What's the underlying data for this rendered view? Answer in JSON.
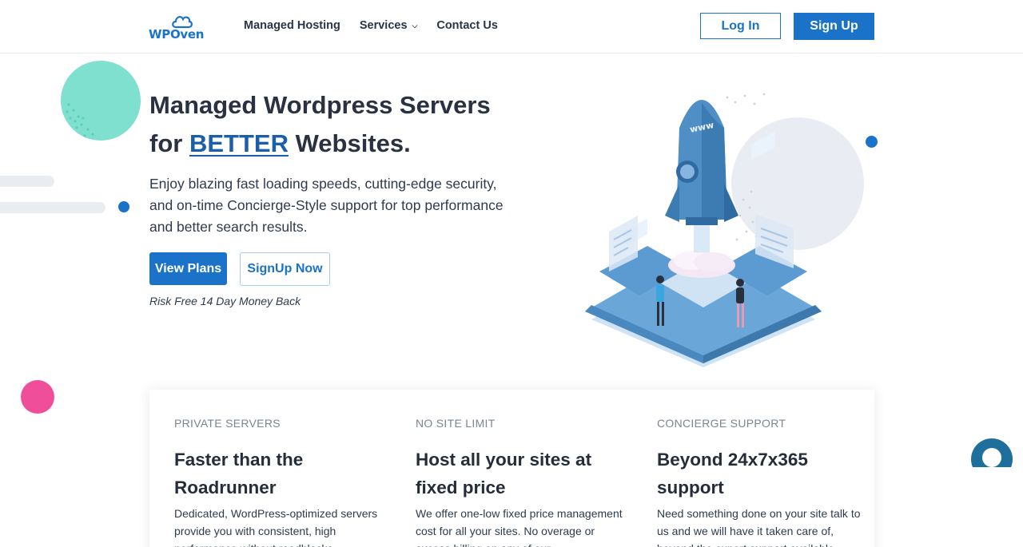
{
  "header": {
    "logo_text": "WPOven",
    "nav": [
      {
        "label": "Managed Hosting"
      },
      {
        "label": "Services"
      },
      {
        "label": "Contact Us"
      }
    ],
    "login_label": "Log In",
    "signup_label": "Sign Up"
  },
  "hero": {
    "title_line1": "Managed Wordpress Servers",
    "title_for": "for",
    "title_highlight": "BETTER",
    "title_rest": "Websites.",
    "description": "Enjoy blazing fast loading speeds, cutting-edge security, and on-time Concierge-Style support for top performance and better search results.",
    "btn_plans": "View Plans",
    "btn_signupnow": "SignUp Now",
    "risk_text": "Risk Free 14 Day Money Back",
    "illustration_label": "www"
  },
  "features": [
    {
      "label": "PRIVATE SERVERS",
      "title": "Faster than the Roadrunner",
      "desc": "Dedicated, WordPress-optimized servers provide you with consistent, high performance without roadblocks"
    },
    {
      "label": "NO SITE LIMIT",
      "title": "Host all your sites at fixed price",
      "desc": "We offer one-low fixed price management cost for all your sites. No overage or excess billing on any of our"
    },
    {
      "label": "CONCIERGE SUPPORT",
      "title": "Beyond 24x7x365 support",
      "desc": "Need something done on your site talk to us and we will have it taken care of, beyond the expert support available"
    }
  ],
  "colors": {
    "brand_blue": "#1a73c8",
    "teal": "#7fe0cf",
    "pink": "#ef4e9a"
  },
  "icons": {
    "logo": "cloud-logo-icon",
    "chat": "chat-support-icon"
  }
}
